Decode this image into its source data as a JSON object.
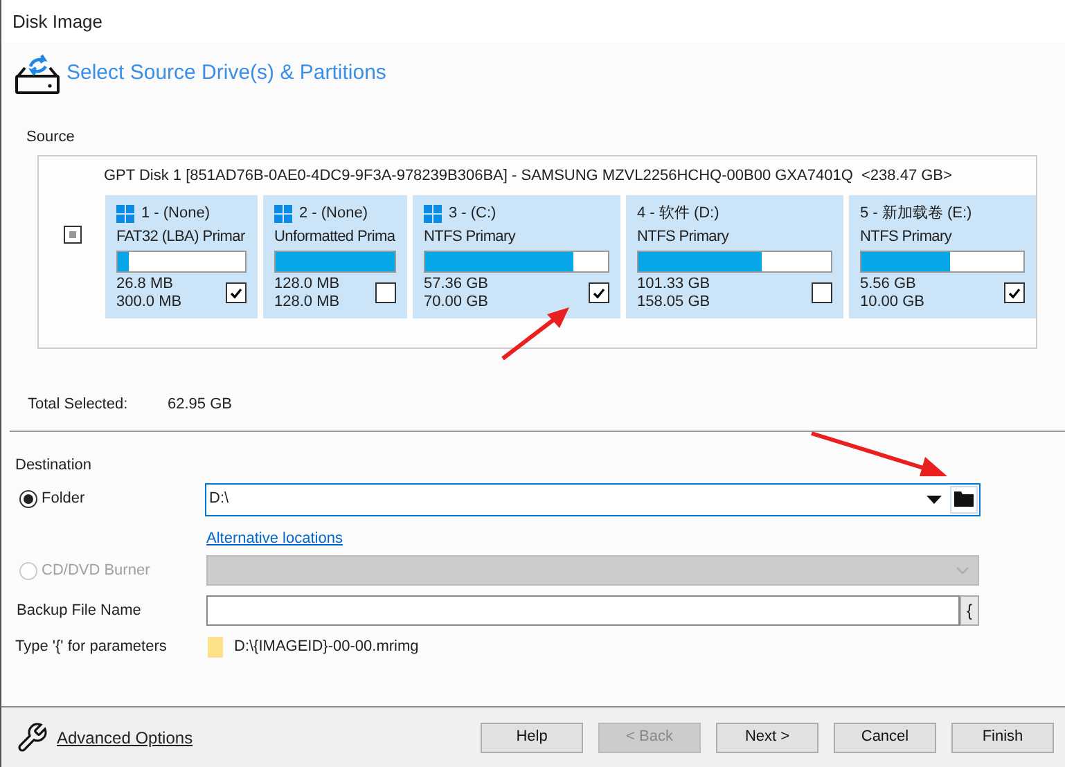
{
  "window": {
    "title": "Disk Image"
  },
  "header": {
    "title": "Select Source Drive(s) & Partitions"
  },
  "source": {
    "label": "Source",
    "disk": {
      "label": "GPT Disk 1 [851AD76B-0AE0-4DC9-9F3A-978239B306BA] - SAMSUNG MZVL2256HCHQ-00B00 GXA7401Q  <238.47 GB>",
      "partial": true
    },
    "partitions": [
      {
        "kind": "windows",
        "title": "1 -  (None)",
        "type": "FAT32 (LBA) Primar",
        "level": 0.09,
        "used": "26.8 MB",
        "total": "300.0 MB",
        "checked": true
      },
      {
        "kind": "windows",
        "title": "2 -  (None)",
        "type": "Unformatted Prima",
        "level": 1.0,
        "used": "128.0 MB",
        "total": "128.0 MB",
        "checked": false
      },
      {
        "kind": "windows",
        "title": "3 -  (C:)",
        "type": "NTFS Primary",
        "level": 0.81,
        "used": "57.36 GB",
        "total": "70.00 GB",
        "checked": true
      },
      {
        "kind": "plain",
        "title": "4 - 软件 (D:)",
        "type": "NTFS Primary",
        "level": 0.64,
        "used": "101.33 GB",
        "total": "158.05 GB",
        "checked": false
      },
      {
        "kind": "plain",
        "title": "5 - 新加载卷 (E:)",
        "type": "NTFS Primary",
        "level": 0.55,
        "used": "5.56 GB",
        "total": "10.00 GB",
        "checked": true
      }
    ]
  },
  "total_selected": {
    "label": "Total Selected:",
    "value": "62.95 GB"
  },
  "destination": {
    "label": "Destination",
    "options": [
      {
        "label": "Folder",
        "selected": true,
        "disabled": false,
        "value": "D:\\"
      },
      {
        "label": "CD/DVD Burner",
        "selected": false,
        "disabled": true
      }
    ],
    "alternative_link": "Alternative locations",
    "backup_file_name": {
      "label": "Backup File Name",
      "brace_button": "{"
    },
    "parameters": {
      "label": "Type '{' for parameters",
      "example": "D:\\{IMAGEID}-00-00.mrimg"
    }
  },
  "footer": {
    "advanced_link": "Advanced Options",
    "buttons": [
      {
        "label": "Help",
        "disabled": false
      },
      {
        "label": "< Back",
        "disabled": true
      },
      {
        "label": "Next >",
        "disabled": false
      },
      {
        "label": "Cancel",
        "disabled": false
      },
      {
        "label": "Finish",
        "disabled": false
      }
    ]
  }
}
